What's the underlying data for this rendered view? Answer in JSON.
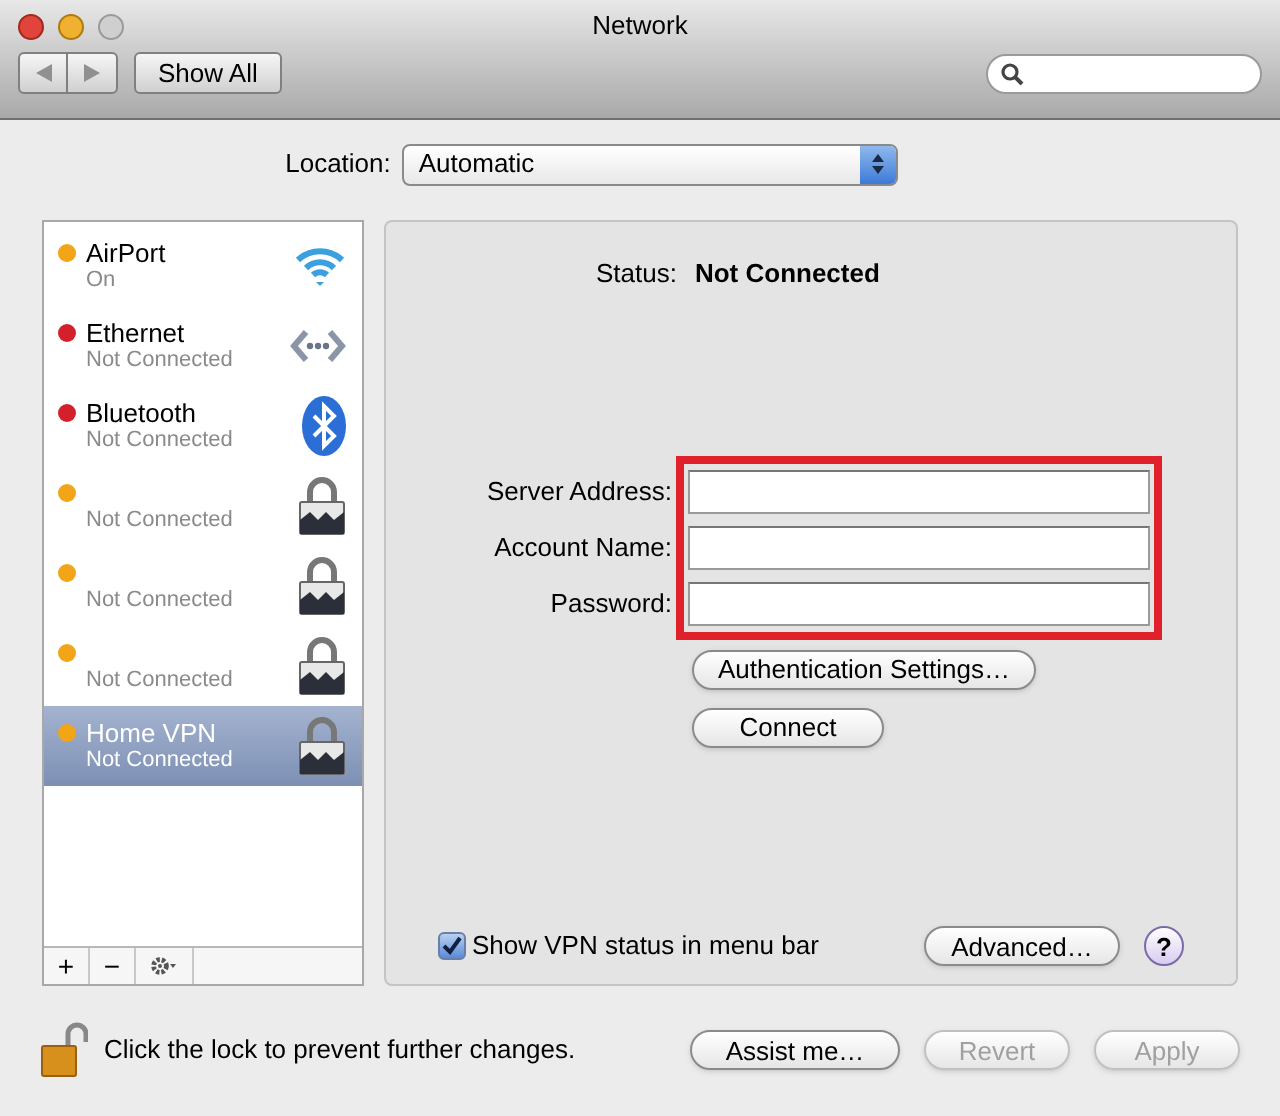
{
  "window": {
    "title": "Network"
  },
  "toolbar": {
    "show_all": "Show All"
  },
  "location": {
    "label": "Location:",
    "value": "Automatic"
  },
  "services": [
    {
      "name": "AirPort",
      "status": "On",
      "color": "#f2a516",
      "kind": "wifi",
      "selected": false
    },
    {
      "name": "Ethernet",
      "status": "Not Connected",
      "color": "#d3202a",
      "kind": "ethernet",
      "selected": false
    },
    {
      "name": "Bluetooth",
      "status": "Not Connected",
      "color": "#d3202a",
      "kind": "bluetooth",
      "selected": false
    },
    {
      "status": "Not Connected",
      "color": "#f2a516",
      "kind": "lock",
      "selected": false
    },
    {
      "status": "Not Connected",
      "color": "#f2a516",
      "kind": "lock",
      "selected": false
    },
    {
      "status": "Not Connected",
      "color": "#f2a516",
      "kind": "lock",
      "selected": false
    },
    {
      "name": "Home VPN",
      "status": "Not Connected",
      "color": "#f2a516",
      "kind": "lock",
      "selected": true
    }
  ],
  "list_actions": {
    "add": "+",
    "remove": "−"
  },
  "detail": {
    "status_label": "Status:",
    "status_value": "Not Connected",
    "fields": [
      {
        "label": "Server Address:"
      },
      {
        "label": "Account Name:"
      },
      {
        "label": "Password:"
      }
    ],
    "auth_button": "Authentication Settings…",
    "connect_button": "Connect",
    "show_status": {
      "label": "Show VPN status in menu bar",
      "checked": true
    },
    "advanced_button": "Advanced…",
    "help": "?"
  },
  "footer": {
    "lock_text": "Click the lock to prevent further changes.",
    "buttons": [
      {
        "label": "Assist me…",
        "disabled": false
      },
      {
        "label": "Revert",
        "disabled": true
      },
      {
        "label": "Apply",
        "disabled": true
      }
    ]
  }
}
